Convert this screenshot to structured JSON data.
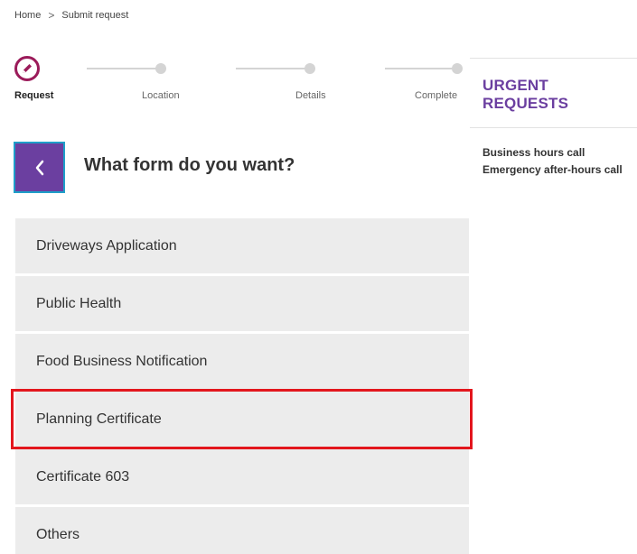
{
  "breadcrumb": {
    "home": "Home",
    "separator": ">",
    "current": "Submit request"
  },
  "stepper": {
    "steps": [
      {
        "label": "Request",
        "state": "active"
      },
      {
        "label": "Location",
        "state": "pending"
      },
      {
        "label": "Details",
        "state": "pending"
      },
      {
        "label": "Complete",
        "state": "pending"
      }
    ],
    "active_color": "#9b1b5a",
    "inactive_color": "#d4d4d4"
  },
  "main": {
    "title": "What form do you want?",
    "back_icon": "chevron-left-icon",
    "forms": [
      {
        "label": "Driveways Application"
      },
      {
        "label": "Public Health"
      },
      {
        "label": "Food Business Notification"
      },
      {
        "label": "Planning Certificate",
        "highlighted": true
      },
      {
        "label": "Certificate 603"
      },
      {
        "label": "Others"
      }
    ]
  },
  "sidebar": {
    "title": "URGENT REQUESTS",
    "links": [
      "Business hours call",
      "Emergency after-hours call"
    ]
  },
  "colors": {
    "accent": "#6b3fa0",
    "highlight": "#e3161d",
    "item_bg": "#ececec"
  }
}
